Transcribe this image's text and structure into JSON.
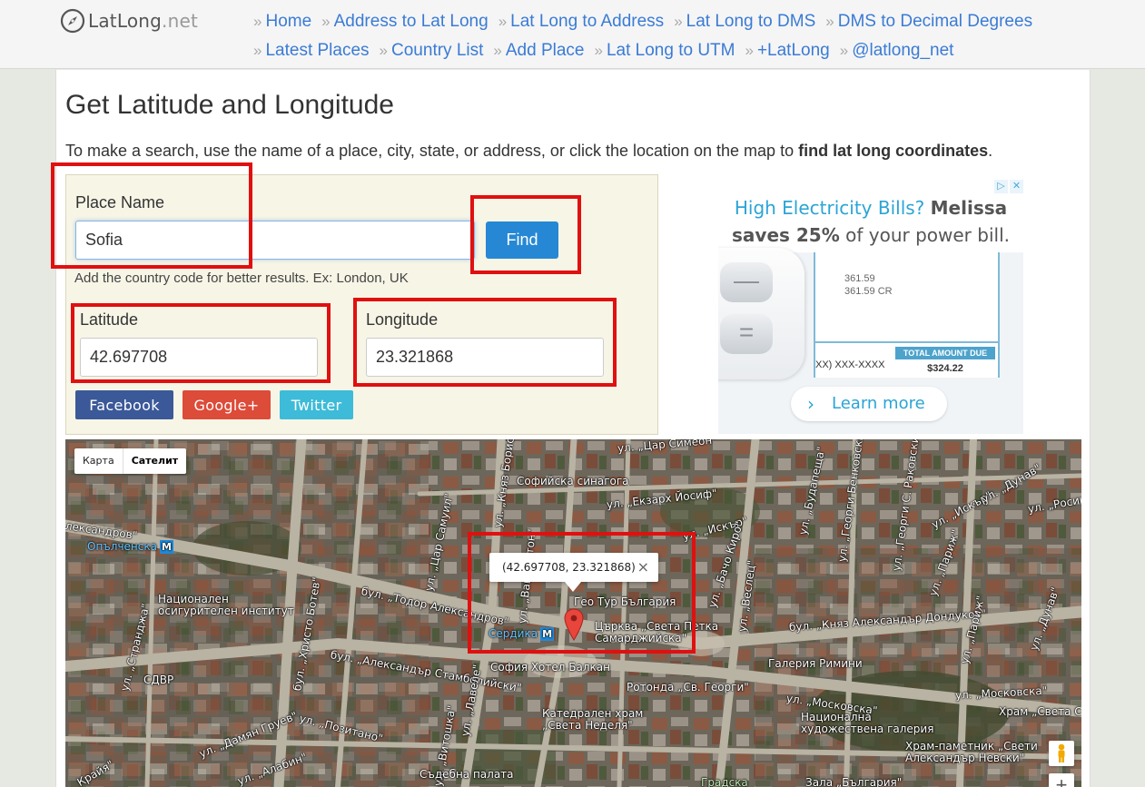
{
  "site": {
    "brand": "LatLong",
    "tld": ".net"
  },
  "nav": {
    "row1": [
      "Home",
      "Address to Lat Long",
      "Lat Long to Address",
      "Lat Long to DMS",
      "DMS to Decimal Degrees"
    ],
    "row2": [
      "Latest Places",
      "Country List",
      "Add Place",
      "Lat Long to UTM",
      "+LatLong",
      "@latlong_net"
    ]
  },
  "page": {
    "title": "Get Latitude and Longitude",
    "intro_prefix": "To make a search, use the name of a place, city, state, or address, or click the location on the map to ",
    "intro_bold": "find lat long coordinates",
    "intro_suffix": "."
  },
  "form": {
    "place_label": "Place Name",
    "place_value": "Sofia",
    "find_label": "Find",
    "hint": "Add the country code for better results. Ex: London, UK",
    "lat_label": "Latitude",
    "lat_value": "42.697708",
    "lng_label": "Longitude",
    "lng_value": "23.321868"
  },
  "share": {
    "facebook": "Facebook",
    "google": "Google+",
    "twitter": "Twitter"
  },
  "ad": {
    "headline_blue": "High Electricity Bills?",
    "headline_bold1": "Melissa",
    "headline_bold2": "saves 25%",
    "headline_rest": "of your power bill.",
    "bill_num1": "361.59",
    "bill_num2": "361.59 CR",
    "account": "XX) XXX-XXXX",
    "total_label": "TOTAL AMOUNT DUE",
    "total_value": "$324.22",
    "cta": "Learn more",
    "key_minus": "—",
    "key_equal": "="
  },
  "map": {
    "type_map": "Карта",
    "type_satellite": "Сателит",
    "infowindow": "(42.697708, 23.321868)",
    "close_glyph": "×",
    "zoom_in": "+",
    "metro": {
      "opalchenska": "Опълченска",
      "serdika": "Сердика",
      "icon": "M"
    },
    "labels": {
      "car_simeon": "ул. „Цар Симеон\"",
      "synagogue": "Софийска синагога",
      "ekzarh": "ул. „Екзарх Йосиф\"",
      "iskar1": "ул. „Искър\"",
      "budapeshta": "ул. „Будапеща\"",
      "benkovski": "ул. „Георги Бенковски\"",
      "rakovski": "ул. „Георги С. Раковски\"",
      "iskar2": "ул. „Искър\"",
      "dunav1": "ул. „Дунав\"",
      "rositsa": "ул. „Росица\"",
      "knyaz_boris": "ул. „Княз Борис I\"",
      "aleksandrov": "лександров\"",
      "car_samuil": "ул. „Цар Самуил\"",
      "washington": "ул. „Вашингтон\"",
      "parizh1": "ул. „Париж\"",
      "bacho_kiro": "ул. „Бачо Киро\"",
      "vesletz": "ул. „Веслец\"",
      "nats_inst": "Национален\nосигурителен институт",
      "todor": "бул. „Тодор Александров\"",
      "geo_tur": "Гео Тур България",
      "church": "Църква „Света Петка\nСамарджийска\"",
      "dondukov": "бул. „Княз Александър Дондуков\"",
      "hristo_botev": "бул. „Христо Ботев\"",
      "stranja": "ул. „Странджа\"",
      "sdvr": "СДВР",
      "stamboliyski": "бул. „Александър Стамболийски\"",
      "sofia_hotel": "София Хотел Балкан",
      "rotunda": "Ротонда „Св. Георги\"",
      "galeria_rimini": "Галерия Римини",
      "moskovska1": "ул. „Московска\"",
      "moskovska2": "ул. „Московска\"",
      "parizh2": "ул. „Париж\"",
      "dunav2": "ул. „Дунав\"",
      "pozitano": "ул. „Позитано\"",
      "lavele": "ул. „Лавеле\"",
      "sveta_nedelya": "Катедрален храм\n„Света Неделя\"",
      "art_gallery": "Национална\nхудожествена галерия",
      "hram_sofia": "Храм „Света Соф",
      "nevski": "Храм-паметник „Свети\nАлександър Невски\"",
      "damyan": "ул. „Дамян Груев\"",
      "vitoshka": "ул. „Витошка\"",
      "court": "Съдебна палата",
      "gradska": "Градска",
      "zala": "Зала „България\"",
      "krai": "Крайя\"",
      "alabin": "ул. „Алабин\""
    }
  }
}
